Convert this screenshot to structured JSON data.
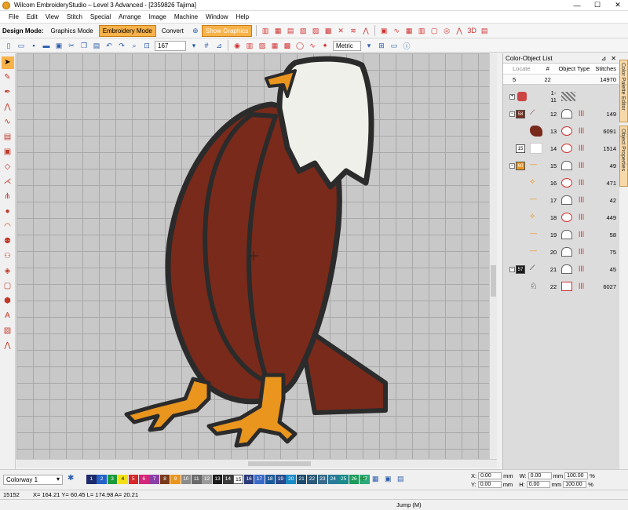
{
  "window": {
    "title": "Wilcom EmbroideryStudio – Level 3 Advanced - [2359826        Tajima]",
    "minimize": "—",
    "maximize": "☐",
    "close": "✕"
  },
  "menu": [
    "File",
    "Edit",
    "View",
    "Stitch",
    "Special",
    "Arrange",
    "Image",
    "Machine",
    "Window",
    "Help"
  ],
  "toolbar": {
    "design_mode_label": "Design Mode:",
    "graphics_mode": "Graphics Mode",
    "embroidery_mode": "Embroidery Mode",
    "convert": "Convert",
    "show_graphics": "Show Graphics",
    "zoom": "167",
    "units": "Metric"
  },
  "panel": {
    "title": "Color-Object List",
    "pin": "⊿",
    "close": "✕",
    "columns": {
      "locate": "Locate",
      "num": "#",
      "object_type": "Object Type",
      "stitches": "Stitches"
    },
    "summary": {
      "count": "5",
      "num": "22",
      "stitches": "14970"
    },
    "rows": [
      {
        "swatch": "",
        "num": "1-11",
        "stitches": ""
      },
      {
        "swatch": "58",
        "num": "12",
        "stitches": "149"
      },
      {
        "swatch": "",
        "num": "13",
        "stitches": "6091"
      },
      {
        "swatch": "15",
        "num": "14",
        "stitches": "1514"
      },
      {
        "swatch": "60",
        "num": "15",
        "stitches": "49"
      },
      {
        "swatch": "",
        "num": "16",
        "stitches": "471"
      },
      {
        "swatch": "",
        "num": "17",
        "stitches": "42"
      },
      {
        "swatch": "",
        "num": "18",
        "stitches": "449"
      },
      {
        "swatch": "",
        "num": "19",
        "stitches": "58"
      },
      {
        "swatch": "",
        "num": "20",
        "stitches": "75"
      },
      {
        "swatch": "57",
        "num": "21",
        "stitches": "45"
      },
      {
        "swatch": "",
        "num": "22",
        "stitches": "6027"
      }
    ]
  },
  "side_tabs": [
    "Color Palette Editor",
    "Object Properties"
  ],
  "colorway": "Colorway 1",
  "color_chips": [
    "1",
    "2",
    "3",
    "4",
    "5",
    "6",
    "7",
    "8",
    "9",
    "10",
    "11",
    "12",
    "13",
    "14",
    "15",
    "16",
    "17",
    "18",
    "19",
    "20",
    "21",
    "22",
    "23",
    "24",
    "25",
    "26",
    "27"
  ],
  "coords": {
    "x_label": "X:",
    "x": "0.00",
    "w_label": "W:",
    "w": "0.00",
    "y_label": "Y:",
    "y": "0.00",
    "h_label": "H:",
    "h": "0.00",
    "unit": "mm",
    "pct1": "100.00",
    "pct2": "100.00",
    "pct_unit": "%"
  },
  "status": {
    "stitches": "15152",
    "position": "X= 164.21 Y= 60.45 L= 174.98 A= 20.21",
    "command": "Jump (M)"
  }
}
